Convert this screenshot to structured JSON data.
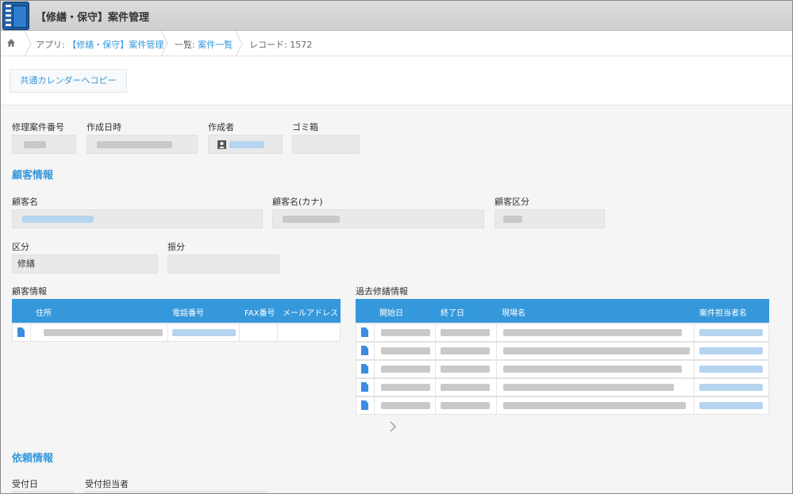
{
  "header": {
    "title": "【修繕・保守】案件管理"
  },
  "breadcrumb": {
    "app_prefix": "アプリ: ",
    "app_link": "【修繕・保守】案件管理",
    "list_prefix": "一覧: ",
    "list_link": "案件一覧",
    "record": "レコード: 1572"
  },
  "toolbar": {
    "copy_button": "共通カレンダーへコピー"
  },
  "fields": {
    "case_number_label": "修理案件番号",
    "created_at_label": "作成日時",
    "creator_label": "作成者",
    "trash_label": "ゴミ箱",
    "customer_name_label": "顧客名",
    "customer_kana_label": "顧客名(カナ)",
    "customer_category_label": "顧客区分",
    "division_label": "区分",
    "division_value": "修繕",
    "allocation_label": "振分",
    "reception_date_label": "受付日",
    "reception_staff_label": "受付担当者"
  },
  "sections": {
    "customer_info": "顧客情報",
    "request_info": "依頼情報"
  },
  "customer_table": {
    "title": "顧客情報",
    "columns": [
      "住所",
      "電話番号",
      "FAX番号",
      "メールアドレス"
    ]
  },
  "history_table": {
    "title": "過去修繕情報",
    "columns": [
      "開始日",
      "終了日",
      "現場名",
      "案件担当者名"
    ]
  },
  "icons": {
    "home": "home-icon",
    "user": "user-icon",
    "document": "document-icon",
    "next": "chevron-right-icon"
  },
  "colors": {
    "accent": "#3498db",
    "header_bg": "#d4d4d4"
  }
}
